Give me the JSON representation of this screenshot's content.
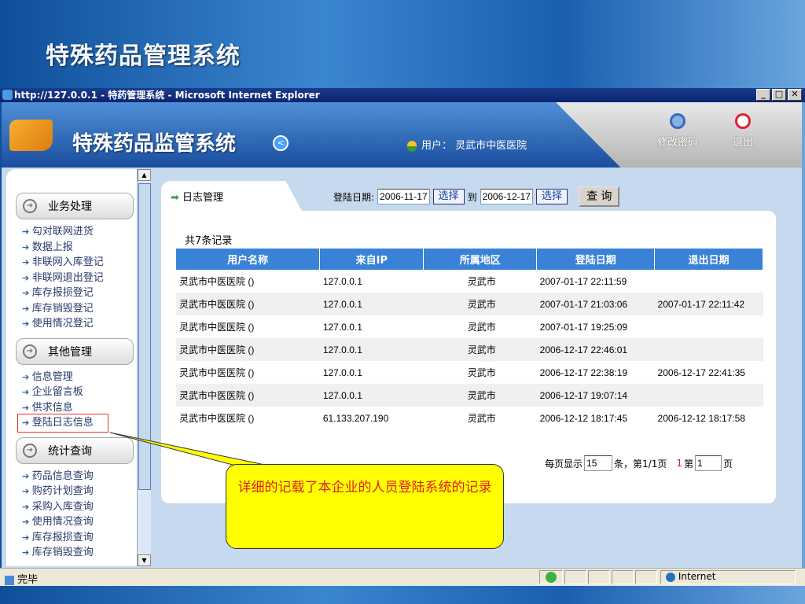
{
  "slide_title": "特殊药品管理系统",
  "window": {
    "title": "http://127.0.0.1 - 特药管理系统 - Microsoft Internet Explorer",
    "min": "_",
    "max": "□",
    "close": "✕"
  },
  "header": {
    "app_title": "特殊药品监管系统",
    "user_label": "用户：",
    "user_name": "灵武市中医医院",
    "change_password": "修改密码",
    "logout": "退出"
  },
  "sidebar": {
    "sections": [
      {
        "title": "业务处理",
        "items": [
          "勾对联网进货",
          "数据上报",
          "非联网入库登记",
          "非联网退出登记",
          "库存报损登记",
          "库存销毁登记",
          "使用情况登记"
        ]
      },
      {
        "title": "其他管理",
        "items": [
          "信息管理",
          "企业留言板",
          "供求信息",
          "登陆日志信息"
        ]
      },
      {
        "title": "统计查询",
        "items": [
          "药品信息查询",
          "购药计划查询",
          "采购入库查询",
          "使用情况查询",
          "库存报损查询",
          "库存销毁查询"
        ]
      }
    ]
  },
  "main": {
    "tab": "日志管理",
    "filter_label": "登陆日期:",
    "from": "2006-11-17",
    "to": "2006-12-17",
    "pick": "选择",
    "to_label": "到",
    "query": "查 询",
    "count": "共7条记录",
    "columns": [
      "用户名称",
      "来自IP",
      "所属地区",
      "登陆日期",
      "退出日期"
    ],
    "rows": [
      [
        "灵武市中医医院 ()",
        "127.0.0.1",
        "灵武市",
        "2007-01-17 22:11:59",
        ""
      ],
      [
        "灵武市中医医院 ()",
        "127.0.0.1",
        "灵武市",
        "2007-01-17 21:03:06",
        "2007-01-17 22:11:42"
      ],
      [
        "灵武市中医医院 ()",
        "127.0.0.1",
        "灵武市",
        "2007-01-17 19:25:09",
        ""
      ],
      [
        "灵武市中医医院 ()",
        "127.0.0.1",
        "灵武市",
        "2006-12-17 22:46:01",
        ""
      ],
      [
        "灵武市中医医院 ()",
        "127.0.0.1",
        "灵武市",
        "2006-12-17 22:38:19",
        "2006-12-17 22:41:35"
      ],
      [
        "灵武市中医医院 ()",
        "127.0.0.1",
        "灵武市",
        "2006-12-17 19:07:14",
        ""
      ],
      [
        "灵武市中医医院 ()",
        "61.133.207.190",
        "灵武市",
        "2006-12-12 18:17:45",
        "2006-12-12 18:17:58"
      ]
    ],
    "pager": {
      "per_page_label": "每页显示",
      "per_page": "15",
      "page_info": "条，第1/1页",
      "page_link": "1",
      "goto_label": "第",
      "goto": "1",
      "page_suffix": "页"
    }
  },
  "status": {
    "text": "完毕",
    "zone": "Internet"
  },
  "callout": "详细的记载了本企业的人员登陆系统的记录"
}
